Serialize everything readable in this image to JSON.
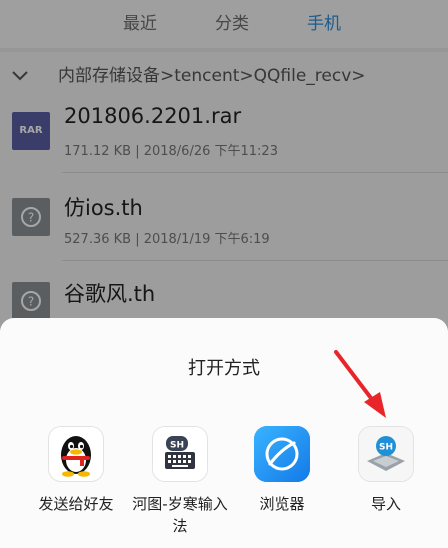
{
  "tabs": [
    {
      "label": "最近",
      "active": false
    },
    {
      "label": "分类",
      "active": false
    },
    {
      "label": "手机",
      "active": true
    }
  ],
  "breadcrumb": {
    "segments": [
      "内部存储设备",
      "tencent",
      "QQfile_recv"
    ],
    "separator": ">"
  },
  "files": [
    {
      "name": "201806.2201.rar",
      "meta": "171.12 KB | 2018/6/26 下午11:23",
      "icon": "rar-file-icon",
      "icon_text": "RAR"
    },
    {
      "name": "仿ios.th",
      "meta": "527.36 KB | 2018/1/19 下午6:19",
      "icon": "unknown-file-icon"
    },
    {
      "name": "谷歌风.th",
      "meta": "",
      "icon": "unknown-file-icon"
    }
  ],
  "sheet": {
    "title": "打开方式",
    "apps": [
      {
        "label": "发送给好友",
        "icon": "qq-penguin-icon"
      },
      {
        "label": "河图-岁寒输入法",
        "icon": "shouxin-keyboard-icon",
        "badge": "SH"
      },
      {
        "label": "浏览器",
        "icon": "browser-compass-icon"
      },
      {
        "label": "导入",
        "icon": "import-skin-icon",
        "badge": "SH"
      }
    ]
  },
  "colors": {
    "accent": "#2f8ed8",
    "annotation_arrow": "#e8262a",
    "rar_icon": "#5a5da3",
    "unknown_icon": "#8c9196"
  }
}
